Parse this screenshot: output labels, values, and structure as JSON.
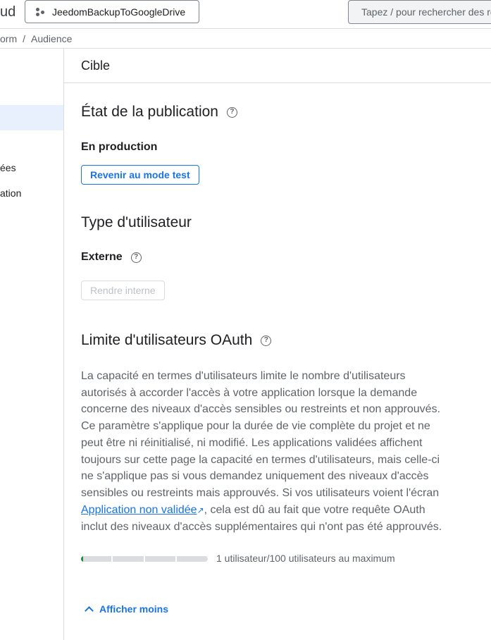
{
  "topbar": {
    "brand_fragment": "ud",
    "project": "JeedomBackupToGoogleDrive",
    "search_placeholder": "Tapez / pour rechercher des re"
  },
  "breadcrumb": [
    "orm",
    "/",
    "Audience"
  ],
  "sidebar": {
    "items": [
      "ées",
      "ation"
    ]
  },
  "header": {
    "title": "Cible"
  },
  "publication": {
    "title": "État de la publication",
    "status": "En production",
    "button": "Revenir au mode test"
  },
  "user_type": {
    "title": "Type d'utilisateur",
    "value": "Externe",
    "button": "Rendre interne"
  },
  "oauth": {
    "title": "Limite d'utilisateurs OAuth",
    "lines": [
      "La capacité en termes d'utilisateurs limite le nombre d'utilisateurs",
      "autorisés à accorder l'accès à votre application lorsque la demande",
      "concerne des niveaux d'accès sensibles ou restreints et non approuvés.",
      "Ce paramètre s'applique pour la durée de vie complète du projet et ne",
      "peut être ni réinitialisé, ni modifié. Les applications validées affichent",
      "toujours sur cette page la capacité en termes d'utilisateurs, mais celle-ci",
      "ne s'applique pas si vous demandez uniquement des niveaux d'accès",
      "sensibles ou restreints mais approuvés. Si vos utilisateurs voient l'écran"
    ],
    "link": "Application non validée",
    "link_after": ", cela est dû au fait que votre requête OAuth",
    "last_line": "inclut des niveaux d'accès supplémentaires qui n'ont pas été approuvés.",
    "usage_fraction": 0.01,
    "usage_label": "1 utilisateur/100 utilisateurs au maximum",
    "show_less": "Afficher moins"
  }
}
